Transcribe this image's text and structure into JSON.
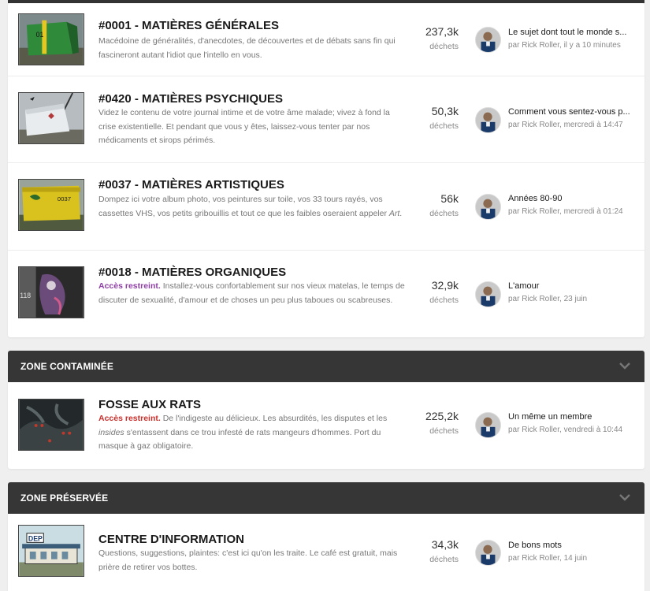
{
  "sections": [
    {
      "header": "",
      "forums": [
        {
          "title": "#0001 - MATIÈRES GÉNÉRALES",
          "restricted": "",
          "description": "Macédoine de généralités, d'anecdotes, de découvertes et de débats sans fin qui fascineront autant l'idiot que l'intello en vous.",
          "count": "237,3k",
          "count_label": "déchets",
          "last_title": "Le sujet dont tout le monde s...",
          "last_meta": "par Rick Roller, il y a 10 minutes"
        },
        {
          "title": "#0420 - MATIÈRES PSYCHIQUES",
          "restricted": "",
          "description": "Videz le contenu de votre journal intime et de votre âme malade; vivez à fond la crise existentielle. Et pendant que vous y êtes, laissez-vous tenter par nos médicaments et sirops périmés.",
          "count": "50,3k",
          "count_label": "déchets",
          "last_title": "Comment vous sentez-vous p...",
          "last_meta": "par Rick Roller, mercredi à 14:47"
        },
        {
          "title": "#0037 - MATIÈRES ARTISTIQUES",
          "restricted": "",
          "description": "Dompez ici votre album photo, vos peintures sur toile, vos 33 tours rayés, vos cassettes VHS, vos petits gribouillis et tout ce que les faibles oseraient appeler",
          "description_italic": "Art",
          "description_end": ".",
          "count": "56k",
          "count_label": "déchets",
          "last_title": "Années 80-90",
          "last_meta": "par Rick Roller, mercredi à 01:24"
        },
        {
          "title": "#0018 - MATIÈRES ORGANIQUES",
          "restricted": "Accès restreint.",
          "description": "Installez-vous confortablement sur nos vieux matelas, le temps de discuter de sexualité, d'amour et de choses un peu plus taboues ou scabreuses.",
          "count": "32,9k",
          "count_label": "déchets",
          "last_title": "L'amour",
          "last_meta": "par Rick Roller, 23 juin"
        }
      ]
    },
    {
      "header": "ZONE CONTAMINÉE",
      "forums": [
        {
          "title": "FOSSE AUX RATS",
          "restricted": "Accès restreint.",
          "description_a": "De l'indigeste au délicieux. Les absurdités, les disputes et les",
          "description_italic": "insides",
          "description_b": "s'entassent dans ce trou infesté de rats mangeurs d'hommes. Port du masque à gaz obligatoire.",
          "count": "225,2k",
          "count_label": "déchets",
          "last_title": "Un même un membre",
          "last_meta": "par Rick Roller, vendredi à 10:44"
        }
      ]
    },
    {
      "header": "ZONE PRÉSERVÉE",
      "forums": [
        {
          "title": "CENTRE D'INFORMATION",
          "restricted": "",
          "description": "Questions, suggestions, plaintes: c'est ici qu'on les traite. Le café est gratuit, mais prière de retirer vos bottes.",
          "count": "34,3k",
          "count_label": "déchets",
          "last_title": "De bons mots",
          "last_meta": "par Rick Roller, 14 juin"
        }
      ]
    }
  ],
  "icons": {
    "collapse": "chevron-down-icon",
    "avatar": "user-avatar"
  },
  "colors": {
    "header_bg": "#363636",
    "restricted_purple": "#8e3ea5",
    "restricted_red": "#c9302c"
  }
}
